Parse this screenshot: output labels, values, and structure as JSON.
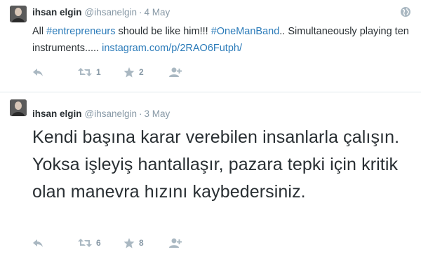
{
  "tweets": [
    {
      "name": "ihsan elgin",
      "handle": "@ihsanelgin",
      "separator": "·",
      "date": "4 May",
      "text_parts": {
        "t1": "All ",
        "hashtag1": "#entrepreneurs",
        "t2": " should be like him!!! ",
        "hashtag2": "#OneManBand",
        "t3": ".. Simultaneously playing ten instruments..... ",
        "link": "instagram.com/p/2RAO6Futph/"
      },
      "retweet_count": "1",
      "favorite_count": "2"
    },
    {
      "name": "ihsan elgin",
      "handle": "@ihsanelgin",
      "separator": "·",
      "date": "3 May",
      "text": "Kendi başına karar verebilen insanlarla çalışın. Yoksa işleyiş hantallaşır, pazara tepki için kritik olan manevra hızını kaybedersiniz.",
      "retweet_count": "6",
      "favorite_count": "8"
    }
  ],
  "colors": {
    "link": "#2b7bb9",
    "muted": "#8899a6",
    "icon": "#aab8c2",
    "text": "#292f33"
  },
  "icons": [
    "globe-icon",
    "reply-icon",
    "retweet-icon",
    "favorite-icon",
    "follow-icon"
  ]
}
